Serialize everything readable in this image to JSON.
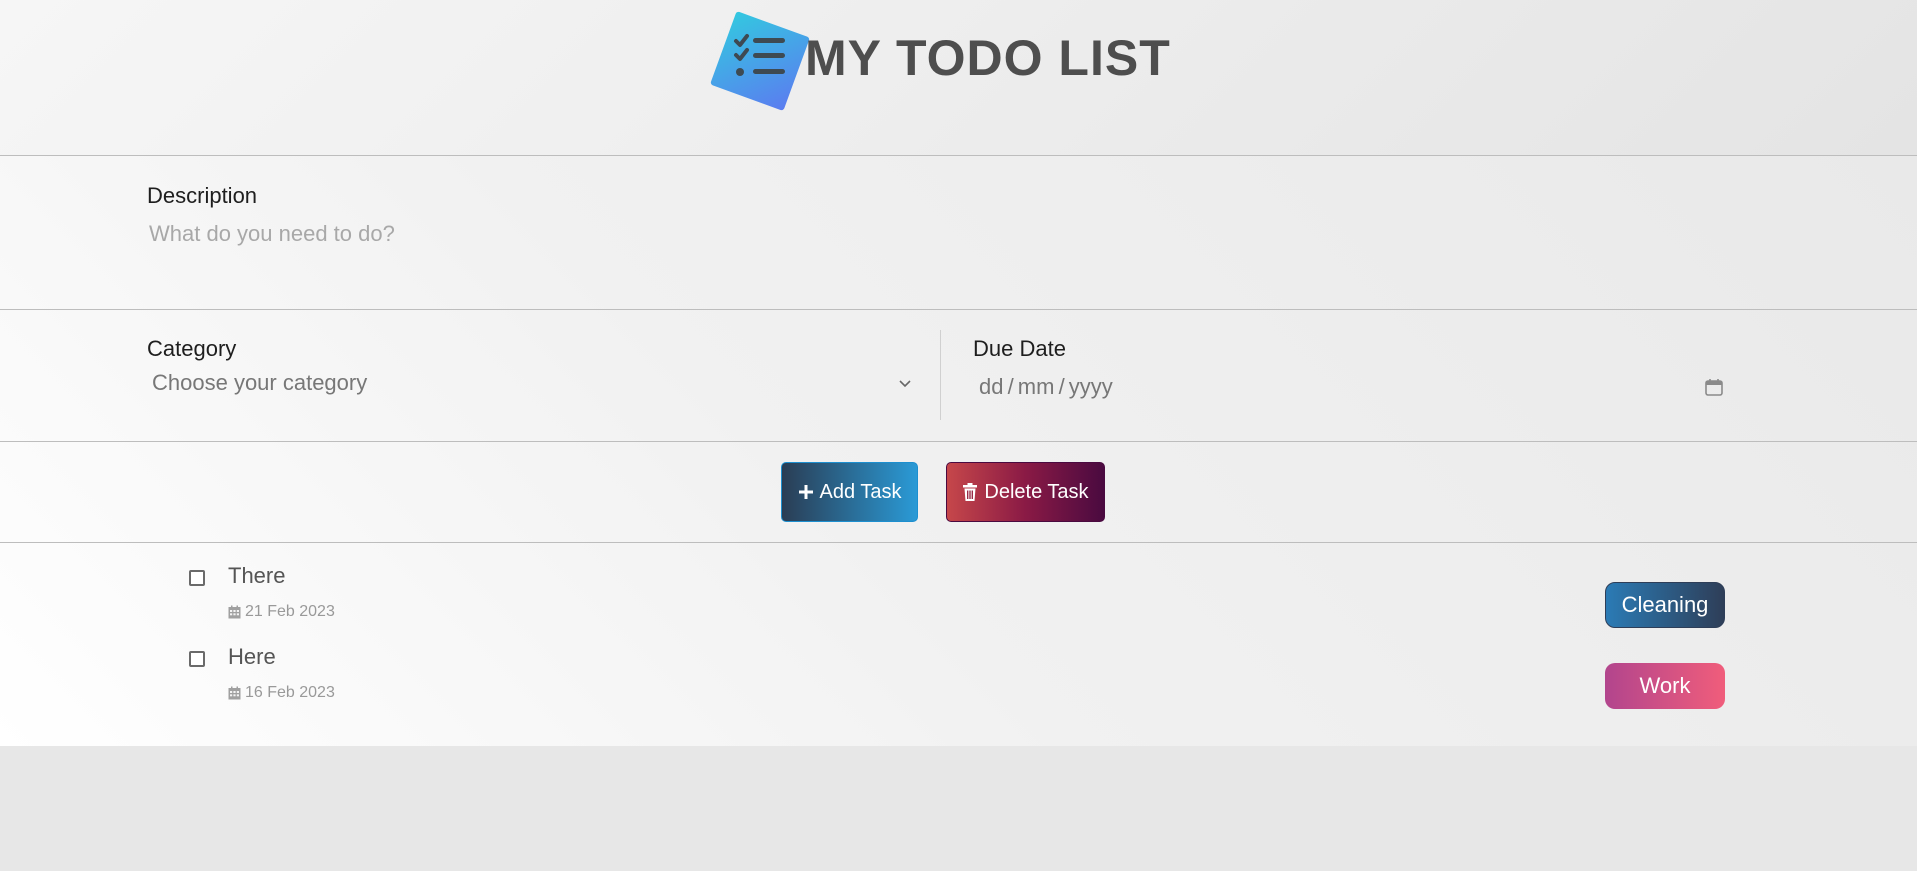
{
  "header": {
    "title": "MY TODO LIST",
    "logo_icon": "checklist-icon",
    "logo_colors": [
      "#33c8e0",
      "#5b7cf0"
    ]
  },
  "form": {
    "description_label": "Description",
    "description_placeholder": "What do you need to do?",
    "description_value": "",
    "category_label": "Category",
    "category_selected": "Choose your category",
    "due_date_label": "Due Date",
    "due_date_placeholder": "dd / mm / yyyy"
  },
  "buttons": {
    "add_label": "Add Task",
    "delete_label": "Delete Task"
  },
  "tasks": [
    {
      "name": "There",
      "date": "21 Feb 2023",
      "category": "Cleaning",
      "category_color": "#2b7bb5",
      "checked": false
    },
    {
      "name": "Here",
      "date": "16 Feb 2023",
      "category": "Work",
      "category_color": "#e0567f",
      "checked": false
    }
  ]
}
